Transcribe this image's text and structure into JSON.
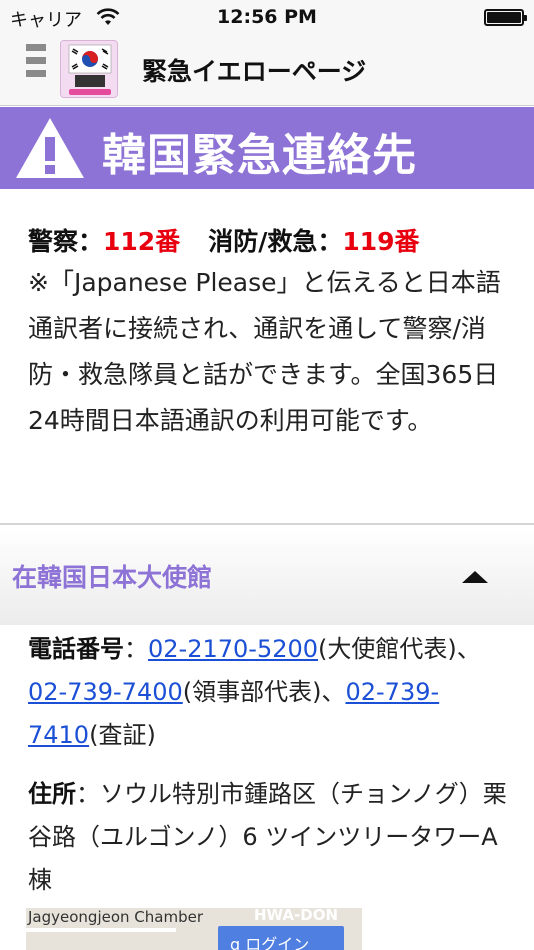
{
  "status_bar": {
    "carrier": "キャリア",
    "time": "12:56 PM"
  },
  "nav": {
    "title": "緊急イエローページ",
    "logo_text": "韓国"
  },
  "banner": {
    "title": "韓国緊急連絡先"
  },
  "emergency": {
    "police_label": "警察：",
    "police_number": "112番",
    "fire_label": "消防/救急：",
    "fire_number": "119番",
    "note": "※「Japanese Please」と伝えると日本語通訳者に接続され、通訳を通して警察/消防・救急隊員と話ができます。全国365日24時間日本語通訳の利用可能です。"
  },
  "embassy_section": {
    "title": "在韓国日本大使館",
    "phone_label": "電話番号",
    "colon": "：",
    "phone_main": "02-2170-5200",
    "phone_main_desc": "(大使館代表)",
    "sep": "、",
    "phone_consular": "02-739-7400",
    "phone_consular_desc": "(領事部代表)",
    "phone_visa": "02-739-7410",
    "phone_visa_desc": "(査証)",
    "address_label": "住所",
    "address": "ソウル特別市鍾路区（チョンノグ）栗谷路（ユルゴンノ）6 ツインツリータワーA棟"
  },
  "map": {
    "label_1": "Jagyeongjeon Chamber",
    "label_2": "HWA-DON",
    "login_button": "g ログイン"
  },
  "colors": {
    "accent": "#8d73d6",
    "emergency_red": "#e8000e",
    "link": "#1a4fd6"
  }
}
